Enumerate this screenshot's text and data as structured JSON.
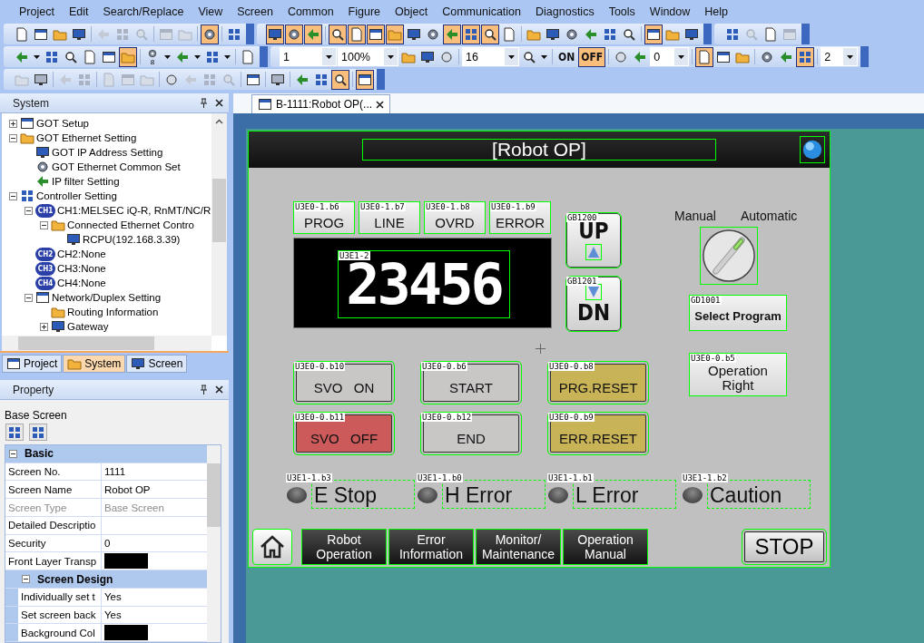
{
  "menu": [
    "Project",
    "Edit",
    "Search/Replace",
    "View",
    "Screen",
    "Common",
    "Figure",
    "Object",
    "Communication",
    "Diagnostics",
    "Tools",
    "Window",
    "Help"
  ],
  "toolbar_rows": [
    [
      [
        {
          "kind": "button",
          "on": false,
          "disabled": false
        },
        {
          "kind": "button",
          "on": false,
          "disabled": false
        },
        {
          "kind": "button",
          "on": false,
          "disabled": false
        },
        {
          "kind": "button",
          "on": false,
          "disabled": false
        },
        {
          "kind": "separator"
        },
        {
          "kind": "button",
          "on": false,
          "disabled": true
        },
        {
          "kind": "button",
          "on": false,
          "disabled": true
        },
        {
          "kind": "button",
          "on": false,
          "disabled": true
        },
        {
          "kind": "separator"
        },
        {
          "kind": "button",
          "on": false,
          "disabled": true
        },
        {
          "kind": "button",
          "on": false,
          "disabled": true
        },
        {
          "kind": "separator"
        },
        {
          "kind": "button",
          "on": true,
          "disabled": false
        },
        {
          "kind": "separator"
        },
        {
          "kind": "button",
          "on": false,
          "disabled": false
        }
      ],
      [
        {
          "kind": "button",
          "on": true,
          "disabled": false
        },
        {
          "kind": "button",
          "on": true,
          "disabled": false
        },
        {
          "kind": "button",
          "on": true,
          "disabled": false
        },
        {
          "kind": "separator"
        },
        {
          "kind": "button",
          "on": true,
          "disabled": false
        },
        {
          "kind": "button",
          "on": true,
          "disabled": false
        },
        {
          "kind": "button",
          "on": true,
          "disabled": false
        },
        {
          "kind": "button",
          "on": true,
          "disabled": false
        },
        {
          "kind": "button",
          "on": false,
          "disabled": false
        },
        {
          "kind": "button",
          "on": false,
          "disabled": false
        },
        {
          "kind": "button",
          "on": true,
          "disabled": false
        },
        {
          "kind": "button",
          "on": true,
          "disabled": false
        },
        {
          "kind": "button",
          "on": true,
          "disabled": false
        },
        {
          "kind": "button",
          "on": false,
          "disabled": false
        },
        {
          "kind": "separator"
        },
        {
          "kind": "button",
          "on": false,
          "disabled": false
        },
        {
          "kind": "button",
          "on": false,
          "disabled": false
        },
        {
          "kind": "button",
          "on": false,
          "disabled": false
        },
        {
          "kind": "button",
          "on": false,
          "disabled": false
        },
        {
          "kind": "button",
          "on": false,
          "disabled": false
        },
        {
          "kind": "button",
          "on": false,
          "disabled": false
        },
        {
          "kind": "separator"
        },
        {
          "kind": "button",
          "on": true,
          "disabled": false
        },
        {
          "kind": "button",
          "on": false,
          "disabled": false
        },
        {
          "kind": "button",
          "on": false,
          "disabled": false
        }
      ],
      [
        {
          "kind": "button",
          "on": false,
          "disabled": false
        },
        {
          "kind": "button",
          "on": false,
          "disabled": true
        },
        {
          "kind": "button",
          "on": false,
          "disabled": false
        },
        {
          "kind": "button",
          "on": false,
          "disabled": true
        }
      ]
    ],
    [
      [
        {
          "kind": "dropdown",
          "on": false,
          "disabled": false
        },
        {
          "kind": "button",
          "on": false,
          "disabled": false
        },
        {
          "kind": "button",
          "on": false,
          "disabled": false
        },
        {
          "kind": "button",
          "on": false,
          "disabled": false
        },
        {
          "kind": "button",
          "on": false,
          "disabled": false
        },
        {
          "kind": "button",
          "on": true,
          "disabled": false
        },
        {
          "kind": "separator"
        },
        {
          "kind": "dropdown",
          "on": false,
          "disabled": false,
          "caption": "8"
        },
        {
          "kind": "dropdown",
          "on": false,
          "disabled": false
        },
        {
          "kind": "dropdown",
          "on": false,
          "disabled": false
        },
        {
          "kind": "separator"
        },
        {
          "kind": "button",
          "on": false,
          "disabled": false
        }
      ],
      [
        {
          "kind": "combo",
          "value": "1"
        },
        {
          "kind": "combo",
          "value": "100%"
        },
        {
          "kind": "button",
          "on": false,
          "disabled": false
        },
        {
          "kind": "button",
          "on": false,
          "disabled": false
        },
        {
          "kind": "button",
          "on": false,
          "disabled": true
        },
        {
          "kind": "separator"
        },
        {
          "kind": "combo",
          "value": "16"
        },
        {
          "kind": "dropdown",
          "on": false,
          "disabled": false
        },
        {
          "kind": "separator"
        },
        {
          "kind": "label",
          "text": "ON",
          "on": false
        },
        {
          "kind": "label",
          "text": "OFF",
          "on": true
        },
        {
          "kind": "separator"
        },
        {
          "kind": "button",
          "on": false,
          "disabled": true
        },
        {
          "kind": "button",
          "on": false,
          "disabled": false
        },
        {
          "kind": "combo",
          "value": "0"
        },
        {
          "kind": "separator"
        },
        {
          "kind": "button",
          "on": true,
          "disabled": false
        },
        {
          "kind": "button",
          "on": false,
          "disabled": false
        },
        {
          "kind": "button",
          "on": false,
          "disabled": false
        },
        {
          "kind": "separator"
        },
        {
          "kind": "button",
          "on": false,
          "disabled": false
        },
        {
          "kind": "button",
          "on": false,
          "disabled": false
        },
        {
          "kind": "button",
          "on": true,
          "disabled": false
        },
        {
          "kind": "separator"
        },
        {
          "kind": "combo",
          "value": "2"
        }
      ]
    ],
    [
      [
        {
          "kind": "button",
          "on": false,
          "disabled": true
        },
        {
          "kind": "button",
          "on": false,
          "disabled": true
        },
        {
          "kind": "separator"
        },
        {
          "kind": "button",
          "on": false,
          "disabled": true
        },
        {
          "kind": "button",
          "on": false,
          "disabled": true
        },
        {
          "kind": "separator"
        },
        {
          "kind": "button",
          "on": false,
          "disabled": true
        },
        {
          "kind": "button",
          "on": false,
          "disabled": true
        },
        {
          "kind": "button",
          "on": false,
          "disabled": true
        },
        {
          "kind": "separator"
        },
        {
          "kind": "button",
          "on": false,
          "disabled": true
        },
        {
          "kind": "button",
          "on": false,
          "disabled": true
        },
        {
          "kind": "button",
          "on": false,
          "disabled": true
        },
        {
          "kind": "button",
          "on": false,
          "disabled": true
        },
        {
          "kind": "separator"
        },
        {
          "kind": "button",
          "on": false,
          "disabled": false
        },
        {
          "kind": "separator"
        },
        {
          "kind": "button",
          "on": false,
          "disabled": true
        },
        {
          "kind": "separator"
        },
        {
          "kind": "button",
          "on": false,
          "disabled": false
        },
        {
          "kind": "button",
          "on": false,
          "disabled": false
        },
        {
          "kind": "button",
          "on": true,
          "disabled": false
        },
        {
          "kind": "separator"
        },
        {
          "kind": "button",
          "on": true,
          "disabled": false
        }
      ]
    ]
  ],
  "system_panel": {
    "title": "System",
    "tree": [
      {
        "label": "GOT Setup",
        "expanded": false
      },
      {
        "label": "GOT Ethernet Setting",
        "expanded": true,
        "children": [
          {
            "label": "GOT IP Address Setting"
          },
          {
            "label": "GOT Ethernet Common Set"
          },
          {
            "label": "IP filter Setting"
          }
        ]
      },
      {
        "label": "Controller Setting",
        "expanded": true,
        "children": [
          {
            "label": "CH1:MELSEC iQ-R, RnMT/NC/R",
            "badge": "CH1",
            "expanded": true,
            "children": [
              {
                "label": "Connected Ethernet Contro",
                "expanded": true,
                "children": [
                  {
                    "label": "RCPU(192.168.3.39)"
                  }
                ]
              }
            ]
          },
          {
            "label": "CH2:None",
            "badge": "CH2"
          },
          {
            "label": "CH3:None",
            "badge": "CH3"
          },
          {
            "label": "CH4:None",
            "badge": "CH4"
          },
          {
            "label": "Network/Duplex Setting",
            "expanded": true,
            "children": [
              {
                "label": "Routing Information"
              },
              {
                "label": "Gateway",
                "expanded": false
              }
            ]
          }
        ]
      }
    ],
    "tabs": [
      {
        "label": "Project",
        "selected": false
      },
      {
        "label": "System",
        "selected": true
      },
      {
        "label": "Screen",
        "selected": false
      }
    ]
  },
  "property_panel": {
    "title": "Property",
    "object": "Base Screen",
    "sections": [
      {
        "name": "Basic",
        "expanded": true,
        "rows": [
          {
            "name": "Screen No.",
            "kind": "text",
            "value": "1111",
            "disabled": false
          },
          {
            "name": "Screen Name",
            "kind": "text",
            "value": "Robot OP",
            "disabled": false
          },
          {
            "name": "Screen Type",
            "kind": "text",
            "value": "Base Screen",
            "disabled": true
          },
          {
            "name": "Detailed Descriptio",
            "kind": "text",
            "disabled": false
          },
          {
            "name": "Security",
            "kind": "text",
            "value": "0",
            "disabled": false
          },
          {
            "name": "Front Layer Transp",
            "kind": "color",
            "color": "#000000",
            "disabled": false
          }
        ]
      },
      {
        "name": "Screen Design",
        "expanded": true,
        "rows": [
          {
            "name": "Individually set t",
            "kind": "text",
            "value": "Yes",
            "disabled": false
          },
          {
            "name": "Set screen back",
            "kind": "text",
            "value": "Yes",
            "disabled": false
          },
          {
            "name": "Background Col",
            "kind": "color",
            "color": "#000000",
            "disabled": false
          }
        ]
      }
    ]
  },
  "document_tab": {
    "title": "B-1111:Robot OP(..."
  },
  "screen": {
    "title": "[Robot OP]",
    "lamps": [
      {
        "device": "U3E0-1.b6",
        "text": "PROG"
      },
      {
        "device": "U3E0-1.b7",
        "text": "LINE"
      },
      {
        "device": "U3E0-1.b8",
        "text": "OVRD"
      },
      {
        "device": "U3E0-1.b9",
        "text": "ERROR"
      }
    ],
    "display": {
      "device": "U3E1-2",
      "value": "23456"
    },
    "step_buttons": [
      {
        "device": "GB1200",
        "text": "UP",
        "kind": "up"
      },
      {
        "device": "GB1201",
        "text": "DN",
        "kind": "down"
      }
    ],
    "selector": {
      "kind": "right",
      "labels": [
        "Manual",
        "Automatic"
      ]
    },
    "select_button": {
      "device": "GD1001",
      "text": "Select Program"
    },
    "buttons": [
      {
        "device": "U3E0-0.b10",
        "text": "SVO   ON",
        "color": "#c9c6c6"
      },
      {
        "device": "U3E0-0.b6",
        "text": "START",
        "color": "#c9c6c6"
      },
      {
        "device": "U3E0-0.b8",
        "text": "PRG.RESET",
        "color": "#c9b357"
      },
      {
        "device": "U3E0-0.b11",
        "text": "SVO   OFF",
        "color": "#cc5a5a"
      },
      {
        "device": "U3E0-0.b12",
        "text": "END",
        "color": "#c9c6c6"
      },
      {
        "device": "U3E0-0.b9",
        "text": "ERR.RESET",
        "color": "#c9b357"
      }
    ],
    "right_button": {
      "device": "U3E0-0.b5",
      "text": "Operation Right"
    },
    "status_lamps": [
      {
        "device": "U3E1-1.b3",
        "text": "E Stop",
        "on": false
      },
      {
        "device": "U3E1-1.b0",
        "text": "H Error",
        "on": false
      },
      {
        "device": "U3E1-1.b1",
        "text": "L Error",
        "on": false
      },
      {
        "device": "U3E1-1.b2",
        "text": "Caution",
        "on": false
      }
    ],
    "nav": [
      "Robot Operation",
      "Error Information",
      "Monitor/ Maintenance",
      "Operation Manual"
    ],
    "stop": "STOP"
  }
}
